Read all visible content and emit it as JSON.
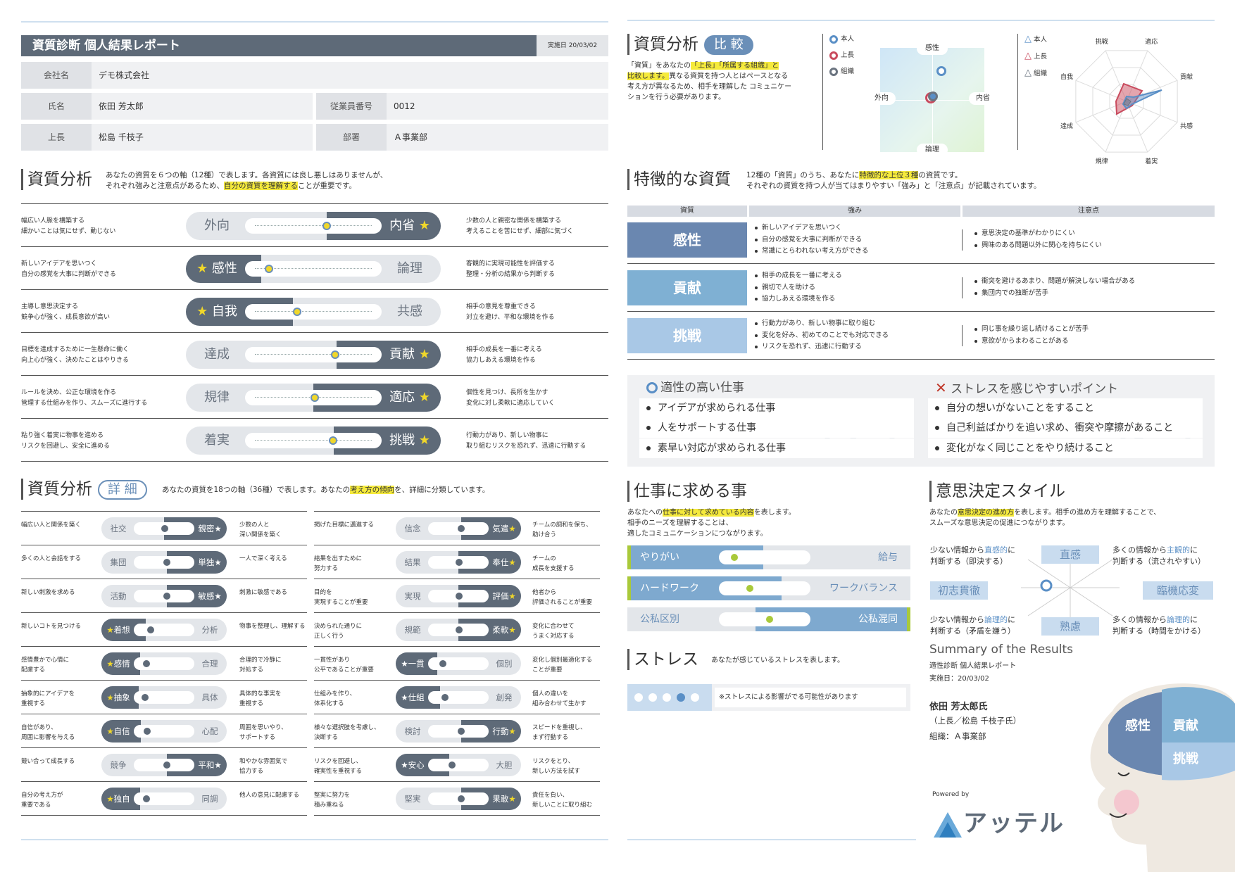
{
  "header": {
    "title": "資質診断 個人結果レポート",
    "date": "実施日 20/03/02",
    "company_label": "会社名",
    "company": "デモ株式会社",
    "name_label": "氏名",
    "name": "依田 芳太郎",
    "empno_label": "従業員番号",
    "empno": "0012",
    "boss_label": "上長",
    "boss": "松島 千枝子",
    "dept_label": "部署",
    "dept": "Ａ事業部"
  },
  "analysis": {
    "title": "資質分析",
    "desc1": "あなたの資質を６つの軸（12種）で表します。各資質には良し悪しはありませんが、",
    "desc2a": "それぞれ強みと注意点があるため、",
    "desc2hl": "自分の資質を理解する",
    "desc2b": "ことが重要です。",
    "rows": [
      {
        "ld": [
          "幅広い人脈を構築する",
          "細かいことは気にせず、動じない"
        ],
        "left": "外向",
        "right": "内省",
        "winner": "right",
        "pos": 0.6,
        "rd": [
          "少数の人と親密な関係を構築する",
          "考えることを苦にせず、細部に気づく"
        ]
      },
      {
        "ld": [
          "新しいアイデアを思いつく",
          "自分の感覚を大事に判断ができる"
        ],
        "left": "感性",
        "right": "論理",
        "winner": "left",
        "pos": 0.12,
        "rd": [
          "客観的に実現可能性を評価する",
          "整理・分析の結果から判断する"
        ]
      },
      {
        "ld": [
          "主導し意思決定する",
          "競争心が強く、成長意欲が高い"
        ],
        "left": "自我",
        "right": "共感",
        "winner": "left",
        "pos": 0.35,
        "rd": [
          "相手の意見を尊重できる",
          "対立を避け、平和な環境を作る"
        ]
      },
      {
        "ld": [
          "目標を達成するために一生懸命に働く",
          "向上心が強く、決めたことはやりきる"
        ],
        "left": "達成",
        "right": "貢献",
        "winner": "right",
        "pos": 0.67,
        "rd": [
          "相手の成長を一番に考える",
          "協力しあえる環境を作る"
        ]
      },
      {
        "ld": [
          "ルールを決め、公正な環境を作る",
          "管理する仕組みを作り、スムーズに進行する"
        ],
        "left": "規律",
        "right": "適応",
        "winner": "right",
        "pos": 0.5,
        "rd": [
          "個性を見つけ、長所を生かす",
          "変化に対し柔軟に適応していく"
        ]
      },
      {
        "ld": [
          "粘り強く着実に物事を進める",
          "リスクを回避し、安全に進める"
        ],
        "left": "着実",
        "right": "挑戦",
        "winner": "right",
        "pos": 0.65,
        "rd": [
          "行動力があり、新しい物事に",
          "取り組むリスクを恐れず、迅速に行動する"
        ]
      }
    ]
  },
  "detail": {
    "title": "資質分析",
    "pill": "詳 細",
    "desc_a": "あなたの資質を18つの軸（36種）で表します。あなたの",
    "desc_hl": "考え方の傾向",
    "desc_b": "を、詳細に分類しています。",
    "col1": [
      {
        "ld": [
          "幅広い人と関係を築く"
        ],
        "left": "社交",
        "right": "親密",
        "winner": "right",
        "pos": 0.5,
        "rd": [
          "少数の人と",
          "深い関係を築く"
        ]
      },
      {
        "ld": [
          "多くの人と会話をする"
        ],
        "left": "集団",
        "right": "単独",
        "winner": "right",
        "pos": 0.55,
        "rd": [
          "一人で深く考える"
        ]
      },
      {
        "ld": [
          "新しい刺激を求める"
        ],
        "left": "活動",
        "right": "敏感",
        "winner": "right",
        "pos": 0.55,
        "rd": [
          "刺激に敏感である"
        ]
      },
      {
        "ld": [
          "新しいコトを見つける"
        ],
        "left": "着想",
        "right": "分析",
        "winner": "left",
        "pos": 0.2,
        "rd": [
          "物事を整理し、理解する"
        ]
      },
      {
        "ld": [
          "感情豊かで心情に",
          "配慮する"
        ],
        "left": "感情",
        "right": "合理",
        "winner": "left",
        "pos": 0.1,
        "rd": [
          "合理的で冷静に",
          "対処する"
        ]
      },
      {
        "ld": [
          "抽象的にアイデアを",
          "重視する"
        ],
        "left": "抽象",
        "right": "具体",
        "winner": "left",
        "pos": 0.08,
        "rd": [
          "具体的な事実を",
          "重視する"
        ]
      },
      {
        "ld": [
          "自信があり、",
          "周囲に影響を与える"
        ],
        "left": "自信",
        "right": "心配",
        "winner": "left",
        "pos": 0.12,
        "rd": [
          "周囲を思いやり、",
          "サポートする"
        ]
      },
      {
        "ld": [
          "競い合って成長する"
        ],
        "left": "競争",
        "right": "平和",
        "winner": "right",
        "pos": 0.55,
        "rd": [
          "和やかな雰囲気で",
          "協力する"
        ]
      },
      {
        "ld": [
          "自分の考え方が",
          "重要である"
        ],
        "left": "独自",
        "right": "同調",
        "winner": "left",
        "pos": 0.1,
        "rd": [
          "他人の意見に配慮する"
        ]
      }
    ],
    "col2": [
      {
        "ld": [
          "掲げた目標に邁進する"
        ],
        "left": "信念",
        "right": "気遣",
        "winner": "right",
        "pos": 0.55,
        "rd": [
          "チームの調和を保ち、",
          "助け合う"
        ]
      },
      {
        "ld": [
          "結果を出すために",
          "努力する"
        ],
        "left": "結果",
        "right": "奉仕",
        "winner": "right",
        "pos": 0.5,
        "rd": [
          "チームの",
          "成長を支援する"
        ]
      },
      {
        "ld": [
          "目的を",
          "実現することが重要"
        ],
        "left": "実現",
        "right": "評価",
        "winner": "right",
        "pos": 0.5,
        "rd": [
          "他者から",
          "評価されることが重要"
        ]
      },
      {
        "ld": [
          "決められた通りに",
          "正しく行う"
        ],
        "left": "規範",
        "right": "柔軟",
        "winner": "right",
        "pos": 0.5,
        "rd": [
          "変化に合わせて",
          "うまく対応する"
        ]
      },
      {
        "ld": [
          "一貫性があり",
          "公平であることが重要"
        ],
        "left": "一貫",
        "right": "個別",
        "winner": "left",
        "pos": 0.15,
        "rd": [
          "変化し個別最適化する",
          "ことが重要"
        ]
      },
      {
        "ld": [
          "仕組みを作り、",
          "体系化する"
        ],
        "left": "仕組",
        "right": "創発",
        "winner": "left",
        "pos": 0.2,
        "rd": [
          "個人の違いを",
          "組み合わせて生かす"
        ]
      },
      {
        "ld": [
          "様々な選択肢を考慮し、",
          "決断する"
        ],
        "left": "検討",
        "right": "行動",
        "winner": "right",
        "pos": 0.55,
        "rd": [
          "スピードを重視し、",
          "まず行動する"
        ]
      },
      {
        "ld": [
          "リスクを回避し、",
          "確実性を重視する"
        ],
        "left": "安心",
        "right": "大胆",
        "winner": "left",
        "pos": 0.35,
        "rd": [
          "リスクをとり、",
          "新しい方法を試す"
        ]
      },
      {
        "ld": [
          "堅実に努力を",
          "積み重ねる"
        ],
        "left": "堅実",
        "right": "果敢",
        "winner": "right",
        "pos": 0.55,
        "rd": [
          "責任を負い、",
          "新しいことに取り組む"
        ]
      }
    ]
  },
  "compare": {
    "title": "資質分析",
    "pill": "比 較",
    "d1a": "「資質」をあなたの",
    "d1hl": "「上長」「所属する組織」と",
    "d2hl": "比較します。",
    "d2b": "異なる資質を持つ人とはペースとなる",
    "d3": "考え方が異なるため、相手を理解した コミュニケー",
    "d4": "ションを行う必要があります。",
    "legend": [
      "本人",
      "上長",
      "組織"
    ],
    "axis_top": "感性",
    "axis_bottom": "論理",
    "axis_left": "外向",
    "axis_right": "内省",
    "radar_labels": [
      "挑戦",
      "適応",
      "貢献",
      "共感",
      "着実",
      "規律",
      "達成",
      "自我"
    ]
  },
  "traits": {
    "title": "特徴的な資質",
    "desc1a": "12種の「資質」のうち、あなたに",
    "desc1hl": "特徴的な上位３種",
    "desc1b": "の資質です。",
    "desc2": "それぞれの資質を持つ人が当てはまりやすい「強み」と「注意点」が記載されています。",
    "headers": [
      "資質",
      "強み",
      "注意点"
    ],
    "rows": [
      {
        "name": "感性",
        "color": "#6a87b0",
        "strengths": [
          "新しいアイデアを思いつく",
          "自分の感覚を大事に判断ができる",
          "常識にとらわれない考え方ができる"
        ],
        "cautions": [
          "意思決定の基準がわかりにくい",
          "興味のある問題以外に関心を持ちにくい"
        ]
      },
      {
        "name": "貢献",
        "color": "#7fb0d3",
        "strengths": [
          "相手の成長を一番に考える",
          "親切で人を助ける",
          "協力しあえる環境を作る"
        ],
        "cautions": [
          "衝突を避けるあまり、問題が解決しない場合がある",
          "集団内での独断が苦手"
        ]
      },
      {
        "name": "挑戦",
        "color": "#a9c8e6",
        "strengths": [
          "行動力があり、新しい物事に取り組む",
          "変化を好み、初めてのことでも対応できる",
          "リスクを恐れず、迅速に行動する"
        ],
        "cautions": [
          "同じ事を繰り返し続けることが苦手",
          "意欲がからまわることがある"
        ]
      }
    ]
  },
  "jobs": {
    "good_title": "適性の高い仕事",
    "good": [
      "アイデアが求められる仕事",
      "人をサポートする仕事",
      "素早い対応が求められる仕事"
    ],
    "stress_title": "ストレスを感じやすいポイント",
    "stress": [
      "自分の想いがないことをすること",
      "自己利益ばかりを追い求め、衝突や摩擦があること",
      "変化がなく同じことをやり続けること"
    ]
  },
  "work": {
    "title": "仕事に求める事",
    "d1a": "あなたへの",
    "d1hl": "仕事に対して求めている内容",
    "d1b": "を表します。",
    "d2": "相手のニーズを理解することは、",
    "d3": "適したコミュニケーションにつながります。",
    "rows": [
      {
        "left": "やりがい",
        "right": "給与",
        "winner": "left",
        "pos": 0.1
      },
      {
        "left": "ハードワーク",
        "right": "ワークバランス",
        "winner": "left",
        "pos": 0.3
      },
      {
        "left": "公私区別",
        "right": "公私混同",
        "winner": "right",
        "pos": 0.55
      }
    ]
  },
  "stress": {
    "title": "ストレス",
    "desc": "あなたが感じているストレスを表します。",
    "level": 4,
    "note": "※ストレスによる影響がでる可能性があります"
  },
  "decision": {
    "title": "意思決定スタイル",
    "d1a": "あなたの",
    "d1hl": "意思決定の進め方",
    "d1b": "を表します。相手の進め方を理解することで、",
    "d2": "スムーズな意思決定の促進につながります。",
    "top": "直感",
    "bottom": "熟慮",
    "left": "初志貫徹",
    "right": "臨機応変",
    "tl1a": "少ない情報から",
    "tl1b": "直感的",
    "tl1c": "に",
    "tl2": "判断する（即決する）",
    "tr1a": "多くの情報から",
    "tr1b": "主観的",
    "tr1c": "に",
    "tr2": "判断する（流されやすい）",
    "bl1a": "少ない情報から",
    "bl1b": "論理的",
    "bl1c": "に",
    "bl2": "判断する（矛盾を嫌う）",
    "br1a": "多くの情報から",
    "br1b": "論理的",
    "br1c": "に",
    "br2": "判断する（時間をかける）"
  },
  "summary": {
    "title": "Summary of the Results",
    "l1": "適性診断 個人結果レポート",
    "l2": "実施日：20/03/02",
    "name": "依田 芳太郎氏",
    "boss": "（上長／松島 千枝子氏）",
    "org": "組織：Ａ事業部",
    "powered": "Powered by",
    "brand": "アッテル",
    "head_traits": [
      "感性",
      "貢献",
      "挑戦"
    ]
  }
}
